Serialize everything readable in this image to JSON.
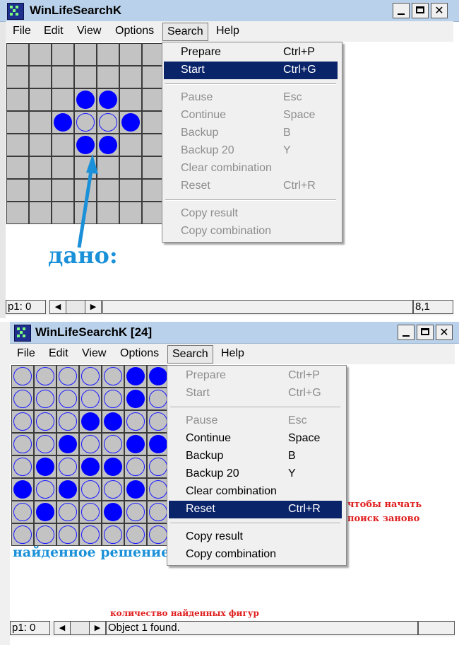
{
  "top_window": {
    "title": "WinLifeSearchK",
    "menu": [
      "File",
      "Edit",
      "View",
      "Options",
      "Search",
      "Help"
    ],
    "active_menu": "Search",
    "close_glyph": "✕",
    "grid": [
      "........",
      "........",
      "...OO...",
      "..O..O..",
      "...OO...",
      "........",
      "........",
      "........"
    ],
    "search_menu": [
      {
        "label": "Prepare",
        "shortcut": "Ctrl+P",
        "state": "enabled"
      },
      {
        "label": "Start",
        "shortcut": "Ctrl+G",
        "state": "highlighted"
      },
      {
        "separator": true
      },
      {
        "label": "Pause",
        "shortcut": "Esc",
        "state": "disabled"
      },
      {
        "label": "Continue",
        "shortcut": "Space",
        "state": "disabled"
      },
      {
        "label": "Backup",
        "shortcut": "B",
        "state": "disabled"
      },
      {
        "label": "Backup 20",
        "shortcut": "Y",
        "state": "disabled"
      },
      {
        "label": "Clear combination",
        "shortcut": "",
        "state": "disabled"
      },
      {
        "label": "Reset",
        "shortcut": "Ctrl+R",
        "state": "disabled"
      },
      {
        "separator": true
      },
      {
        "label": "Copy result",
        "shortcut": "",
        "state": "disabled"
      },
      {
        "label": "Copy combination",
        "shortcut": "",
        "state": "disabled"
      }
    ],
    "annotation": "дано:",
    "status": {
      "generation": "p1: 0",
      "position": "8,1"
    }
  },
  "bottom_window": {
    "title": "WinLifeSearchK [24]",
    "menu": [
      "File",
      "Edit",
      "View",
      "Options",
      "Search",
      "Help"
    ],
    "active_menu": "Search",
    "close_glyph": "✕",
    "grid": [
      ".....OO.",
      ".....O..",
      "...OO...",
      "..O..OO.",
      ".O.OO...",
      "O.O..O..",
      ".O..O...",
      "........"
    ],
    "search_menu": [
      {
        "label": "Prepare",
        "shortcut": "Ctrl+P",
        "state": "disabled"
      },
      {
        "label": "Start",
        "shortcut": "Ctrl+G",
        "state": "disabled"
      },
      {
        "separator": true
      },
      {
        "label": "Pause",
        "shortcut": "Esc",
        "state": "disabled"
      },
      {
        "label": "Continue",
        "shortcut": "Space",
        "state": "enabled"
      },
      {
        "label": "Backup",
        "shortcut": "B",
        "state": "enabled"
      },
      {
        "label": "Backup 20",
        "shortcut": "Y",
        "state": "enabled"
      },
      {
        "label": "Clear combination",
        "shortcut": "",
        "state": "enabled"
      },
      {
        "label": "Reset",
        "shortcut": "Ctrl+R",
        "state": "highlighted"
      },
      {
        "separator": true
      },
      {
        "label": "Copy result",
        "shortcut": "",
        "state": "enabled"
      },
      {
        "label": "Copy combination",
        "shortcut": "",
        "state": "enabled"
      }
    ],
    "annotation_solution": "найденное решение",
    "annotation_reset_line1": "чтобы начать",
    "annotation_reset_line2": "поиск заново",
    "annotation_count": "количество найденных фигур",
    "status": {
      "generation": "p1: 0",
      "message": "Object 1 found."
    }
  },
  "colors": {
    "alive": "#0000ff",
    "cell": "#c3c3c3",
    "menu_highlight": "#0a246a",
    "annotation_blue": "#1a90d8",
    "annotation_red": "#e02020",
    "titlebar": "#b9d1ea"
  },
  "icons": {
    "app": "app-grid-icon",
    "minimize": "minimize-icon",
    "maximize": "maximize-icon",
    "close": "close-icon",
    "scroll_left": "arrow-left-icon",
    "scroll_right": "arrow-right-icon"
  }
}
